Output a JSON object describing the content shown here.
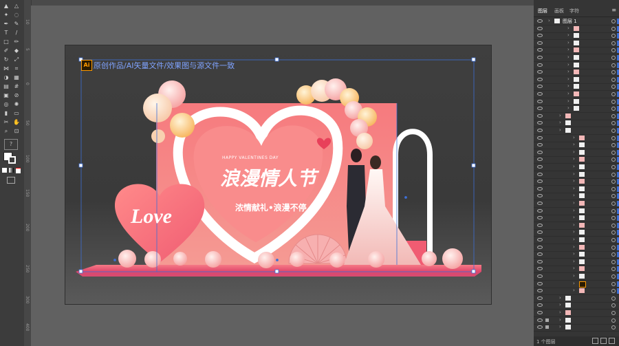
{
  "watermark": "原创作品/AI矢量文件/效果图与源文件一致",
  "ai_badge": "Ai",
  "title_text": "浪漫情人节",
  "happy_text": "HAPPY VALENTINES DAY",
  "subtitle_text": "浓情献礼•浪漫不停",
  "love_text": "Love",
  "panel": {
    "tabs": [
      "图层",
      "画板",
      "字符"
    ],
    "layer_name": "图层 1",
    "footer": "1 个图层"
  },
  "colors": {
    "accent": "#f0707a",
    "pink_light": "#f7a7a7",
    "selection": "#3d6fd6"
  }
}
